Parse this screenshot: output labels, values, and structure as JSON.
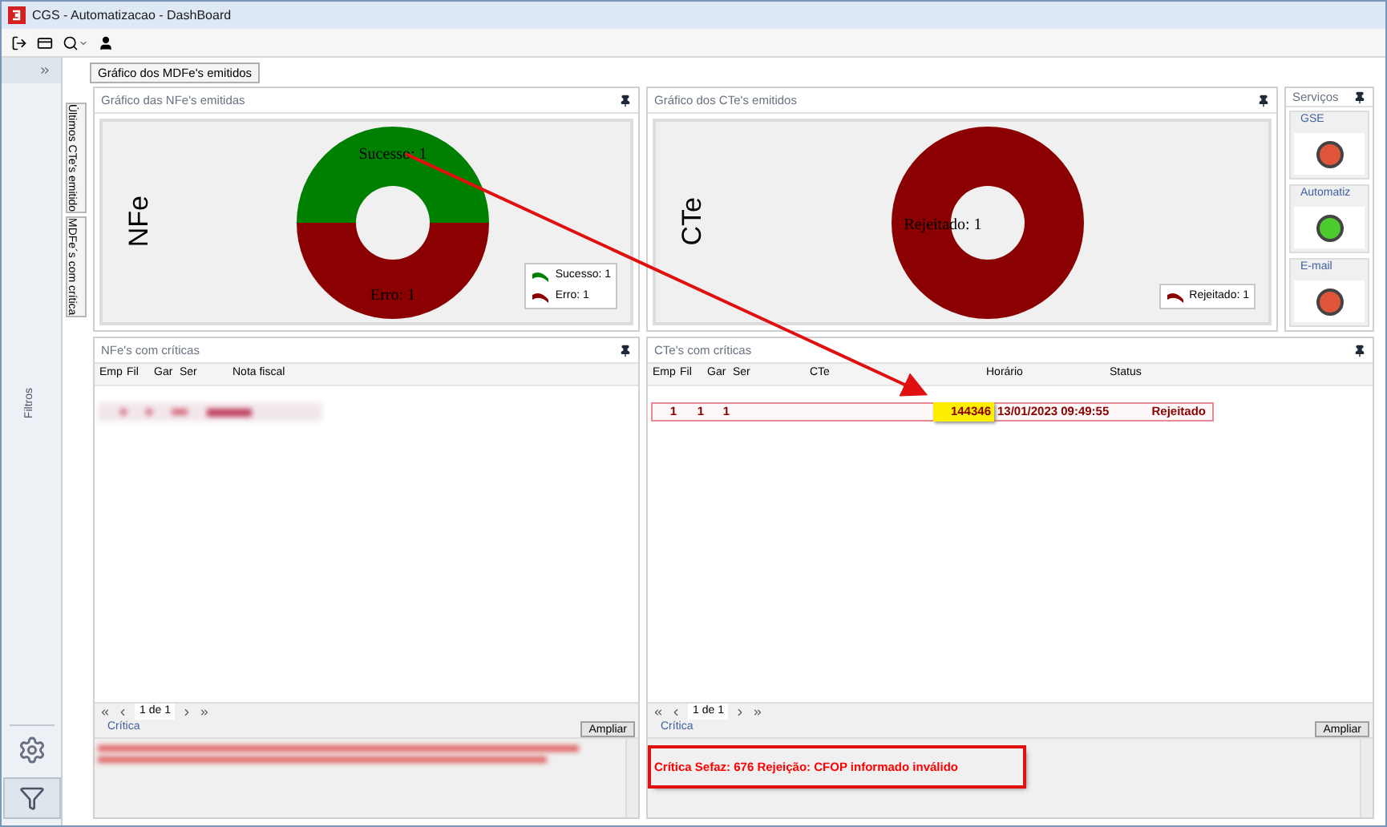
{
  "window": {
    "title": "CGS - Automatizacao - DashBoard"
  },
  "sidebar": {
    "label": "Filtros"
  },
  "side_tabs": [
    {
      "label": "Últimos CTe's emitido"
    },
    {
      "label": "MDFe´s com crítica"
    }
  ],
  "top_tab": {
    "label": "Gráfico dos MDFe's emitidos",
    "selected": true
  },
  "nfe_chart": {
    "title": "Gráfico das NFe's emitidas",
    "legend": [
      "Sucesso: 1",
      "Erro: 1"
    ],
    "chart_data": {
      "type": "donut",
      "ylabel": "NFe",
      "values": [
        1,
        1
      ],
      "colors": [
        "#008000",
        "#8b0000"
      ],
      "value_labels": [
        "Sucesso: 1",
        "Erro: 1"
      ]
    }
  },
  "cte_chart": {
    "title": "Gráfico dos CTe's emitidos",
    "legend": [
      "Rejeitado: 1"
    ],
    "axis_label": "CTe",
    "ring_label": "Rejeitado: 1"
  },
  "services": {
    "title": "Serviços",
    "items": [
      {
        "label": "GSE",
        "color": "#e0553a"
      },
      {
        "label": "Automatiz",
        "color": "#4ccc2c"
      },
      {
        "label": "E-mail",
        "color": "#e0553a"
      }
    ]
  },
  "nfe_table": {
    "title": "NFe's com críticas",
    "columns": [
      "Emp",
      "Fil",
      "Gar",
      "Ser",
      "Nota fiscal"
    ],
    "rows": [
      {
        "kind": "redacted"
      }
    ],
    "pager": "1 de 1",
    "critica_label": "Crítica",
    "expand_button": "Ampliar",
    "critica": {
      "kind": "redacted"
    }
  },
  "cte_table": {
    "title": "CTe's com críticas",
    "columns": [
      "Emp",
      "Fil",
      "Gar",
      "Ser",
      "CTe",
      "Horário",
      "Status"
    ],
    "rows": [
      {
        "kind": "record",
        "emp": "1",
        "fil": "1",
        "gar": "1",
        "cte": "144346",
        "horario": "13/01/2023 09:49:55",
        "status": "Rejeitado",
        "cte_highlighted": true
      }
    ],
    "pager": "1 de 1",
    "critica_label": "Crítica",
    "expand_button": "Ampliar",
    "critica": {
      "kind": "text",
      "text": "Crítica Sefaz: 676 Rejeição: CFOP informado inválido",
      "framed": true
    }
  },
  "annotation": {
    "arrow": true
  }
}
